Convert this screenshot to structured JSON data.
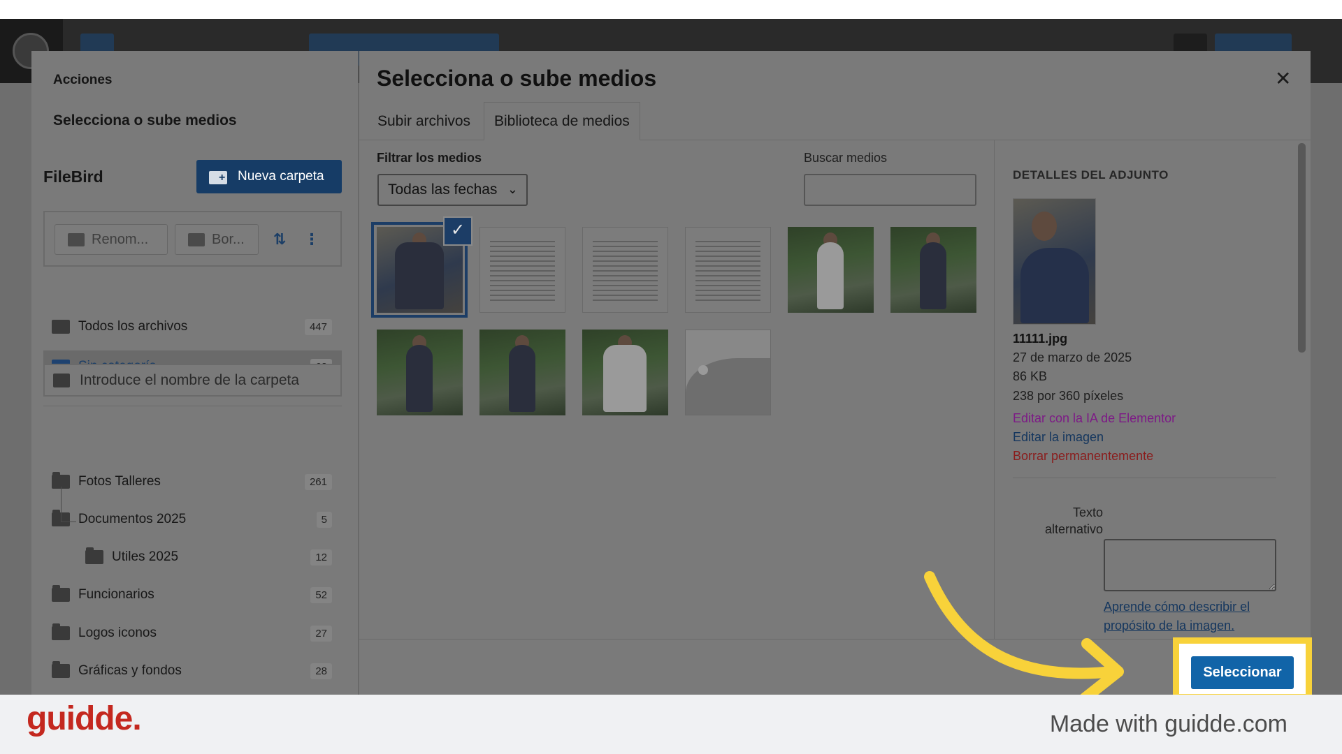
{
  "modal": {
    "menu_heading": "Acciones",
    "menu_active_item": "Selecciona o sube medios",
    "title": "Selecciona o sube medios",
    "close_icon": "close-icon"
  },
  "filebird": {
    "title": "FileBird",
    "new_folder_label": "Nueva carpeta",
    "rename_label": "Renom...",
    "delete_label": "Bor...",
    "sort_icon": "sort-az-icon",
    "more_icon": "more-vertical-icon",
    "all_files": {
      "label": "Todos los archivos",
      "count": "447"
    },
    "uncategorized": {
      "label": "Sin categoría",
      "count": "62"
    },
    "search_placeholder": "Introduce el nombre de la carpeta",
    "folders": [
      {
        "label": "Fotos Talleres",
        "count": "261"
      },
      {
        "label": "Documentos 2025",
        "count": "5"
      },
      {
        "label": "Utiles 2025",
        "count": "12"
      },
      {
        "label": "Funcionarios",
        "count": "52"
      },
      {
        "label": "Logos iconos",
        "count": "27"
      },
      {
        "label": "Gráficas y fondos",
        "count": "28"
      }
    ]
  },
  "tabs": [
    {
      "label": "Subir archivos",
      "active": false
    },
    {
      "label": "Biblioteca de medios",
      "active": true
    }
  ],
  "filters": {
    "filter_label": "Filtrar los medios",
    "date_select": "Todas las fechas",
    "search_label": "Buscar medios",
    "search_value": ""
  },
  "attachment": {
    "heading": "DETALLES DEL ADJUNTO",
    "filename": "11111.jpg",
    "date": "27 de marzo de 2025",
    "size": "86 KB",
    "dimensions": "238 por 360 píxeles",
    "edit_ai": "Editar con la IA de Elementor",
    "edit_image": "Editar la imagen",
    "delete": "Borrar permanentemente",
    "alt_label": "Texto alternativo",
    "alt_value": "",
    "alt_help_link": "Aprende cómo describir el propósito de la imagen",
    "alt_help_suffix": "."
  },
  "select_button": "Seleccionar",
  "footer": {
    "logo": "guidde.",
    "made_with": "Made with guidde.com"
  },
  "colors": {
    "primary": "#1164a8",
    "highlight": "#f8d23a",
    "logo": "#c4281f",
    "ai_link": "#7d1a86",
    "delete_link": "#8a1c1c"
  }
}
